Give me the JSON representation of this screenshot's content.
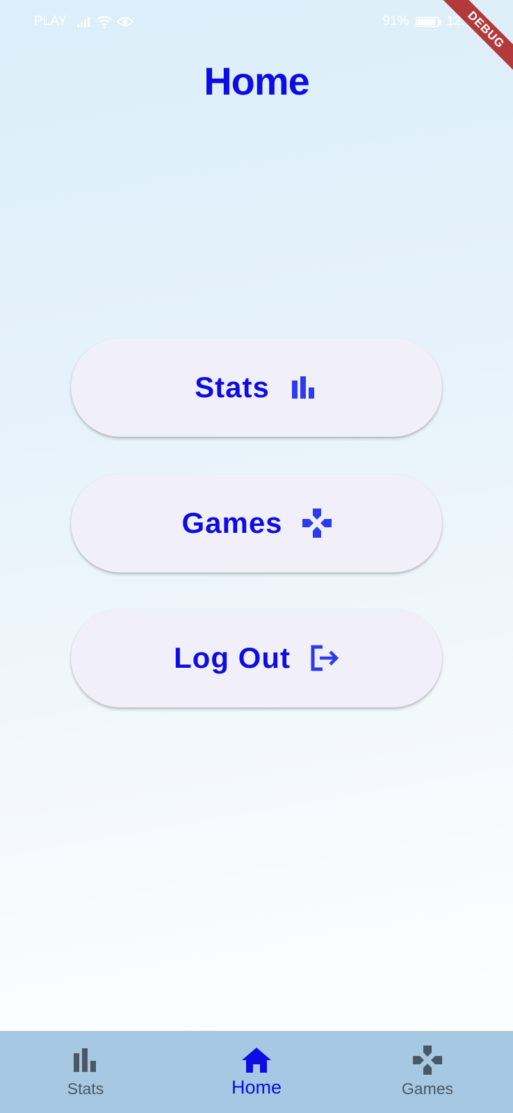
{
  "status_bar": {
    "carrier": "PLAY",
    "battery": "91%",
    "time": "12:41"
  },
  "debug_banner": "DEBUG",
  "page": {
    "title": "Home"
  },
  "buttons": {
    "stats_label": "Stats",
    "games_label": "Games",
    "logout_label": "Log Out"
  },
  "bottom_nav": {
    "items": [
      {
        "label": "Stats",
        "icon": "bar-chart-icon"
      },
      {
        "label": "Home",
        "icon": "home-icon",
        "selected": true
      },
      {
        "label": "Games",
        "icon": "gamepad-icon"
      }
    ]
  },
  "colors": {
    "accent": "#0d0de3",
    "button_bg": "#f1eff9",
    "nav_bg": "#a6c8e2",
    "debug": "#b23a3a"
  }
}
